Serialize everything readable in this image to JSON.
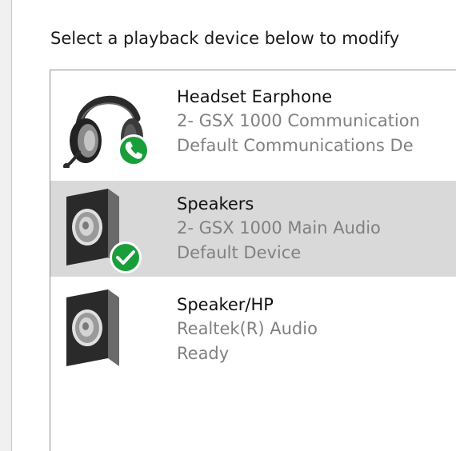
{
  "prompt": "Select a playback device below to modify",
  "devices": [
    {
      "name": "Headset Earphone",
      "driver": "2- GSX 1000 Communication",
      "status": "Default Communications De",
      "icon": "headset-icon",
      "badge": "phone-badge-icon",
      "selected": false
    },
    {
      "name": "Speakers",
      "driver": "2- GSX 1000 Main Audio",
      "status": "Default Device",
      "icon": "speaker-icon",
      "badge": "check-badge-icon",
      "selected": true
    },
    {
      "name": "Speaker/HP",
      "driver": "Realtek(R) Audio",
      "status": "Ready",
      "icon": "speaker-icon",
      "badge": "",
      "selected": false
    }
  ],
  "colors": {
    "selected_row": "#d9d9d9",
    "badge_green": "#1a9e3a",
    "secondary_text": "#808080"
  }
}
